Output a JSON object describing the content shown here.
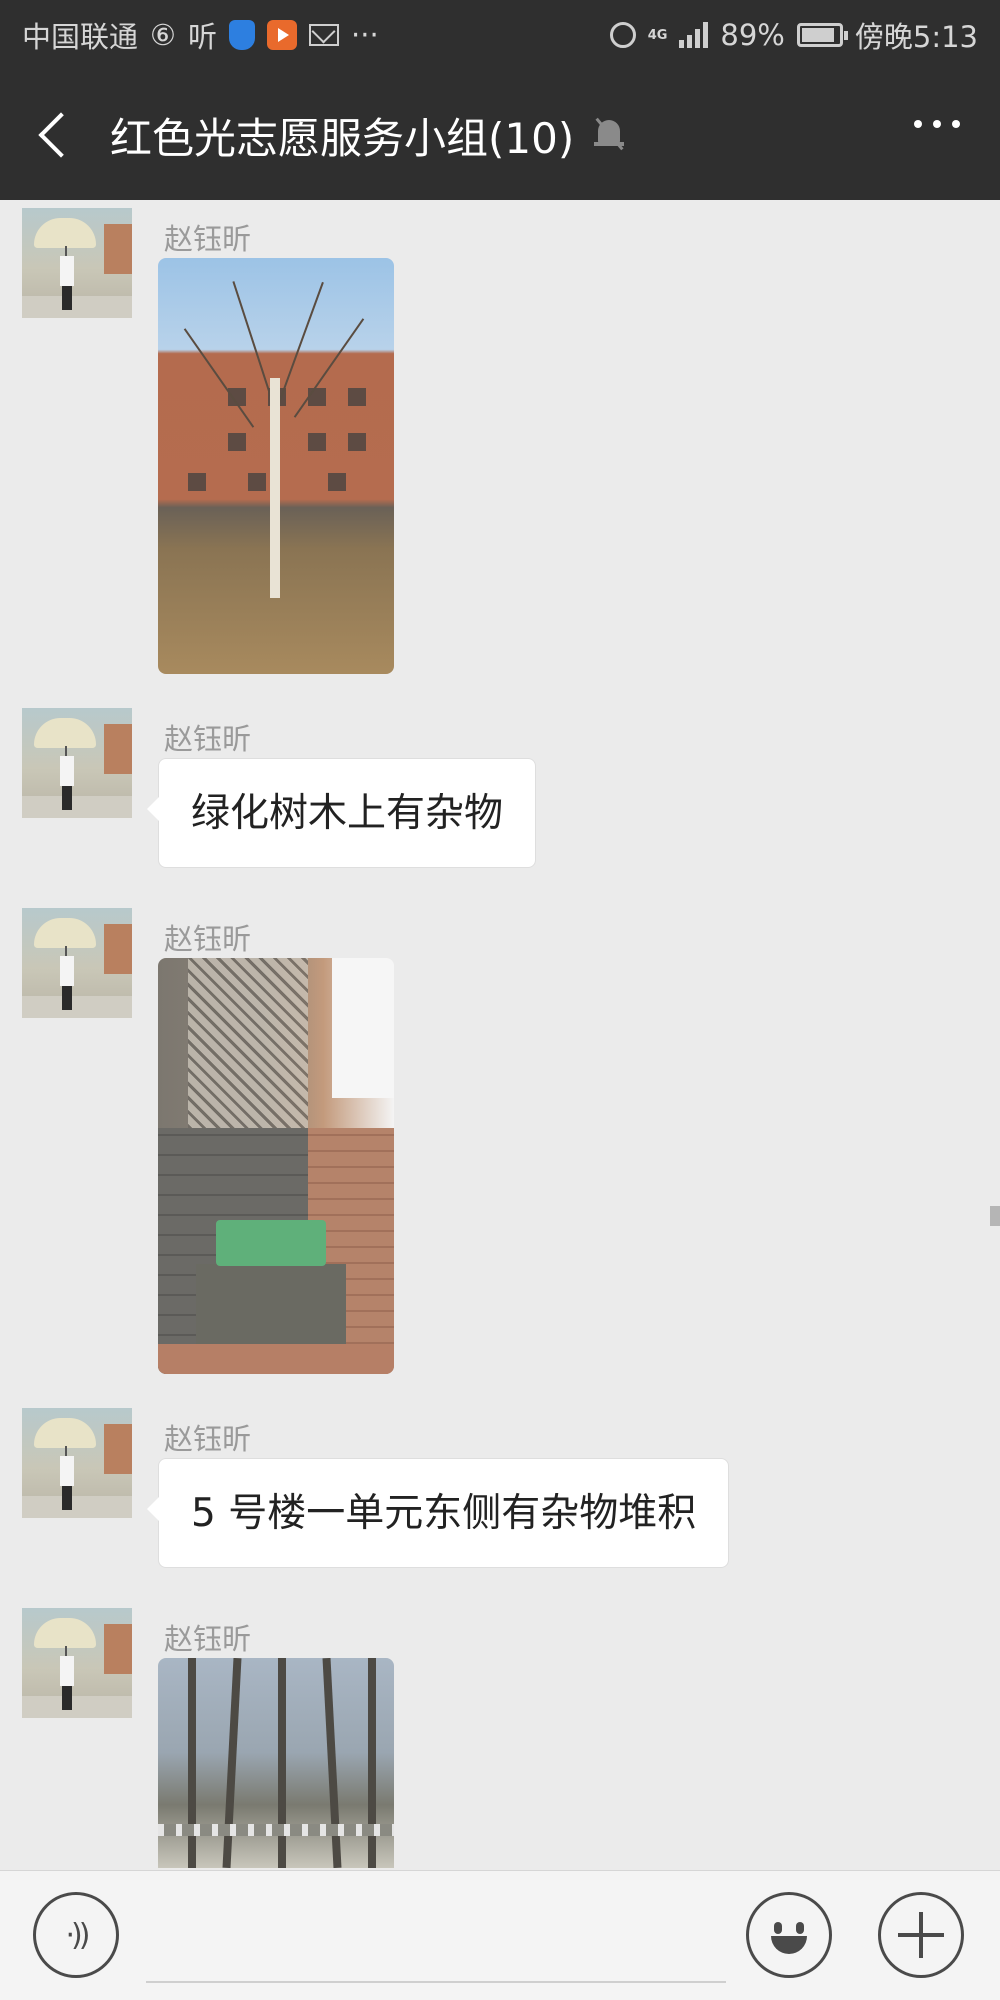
{
  "status_bar": {
    "carrier": "中国联通",
    "weibo_glyph": "⑥",
    "app_glyph": "听",
    "more": "···",
    "network": "4G",
    "battery": "89%",
    "time": "傍晚5:13",
    "battery_level": 0.89
  },
  "header": {
    "title": "红色光志愿服务小组(10)",
    "icons": [
      "back-chevron",
      "mute-bell",
      "more-dots"
    ]
  },
  "messages": [
    {
      "sender": "赵钰昕",
      "type": "image",
      "image_desc": "tree-building-photo"
    },
    {
      "sender": "赵钰昕",
      "type": "text",
      "text": "绿化树木上有杂物"
    },
    {
      "sender": "赵钰昕",
      "type": "image",
      "image_desc": "wall-sidewalk-photo"
    },
    {
      "sender": "赵钰昕",
      "type": "text",
      "text": "5 号楼一单元东侧有杂物堆积"
    },
    {
      "sender": "赵钰昕",
      "type": "image",
      "image_desc": "trees-fence-photo"
    }
  ],
  "input_bar": {
    "placeholder": "",
    "icons": [
      "voice-icon",
      "emoji-icon",
      "plus-icon"
    ]
  },
  "colors": {
    "header_bg": "#2f2f2f",
    "chat_bg": "#ebebeb",
    "bubble_bg": "#ffffff",
    "sender_text": "#9a9a9a"
  }
}
